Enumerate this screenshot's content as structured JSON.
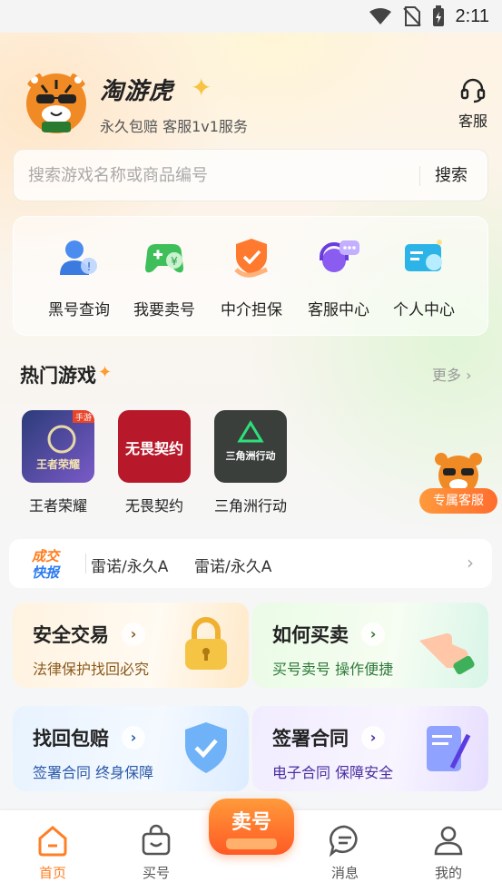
{
  "status_bar": {
    "time": "2:11"
  },
  "header": {
    "app_name": "淘游虎",
    "slogan": "永久包赔 客服1v1服务",
    "customer_service_label": "客服"
  },
  "search": {
    "placeholder": "搜索游戏名称或商品编号",
    "button_label": "搜索"
  },
  "quick_actions": [
    {
      "label": "黑号查询",
      "icon": "user-search-icon"
    },
    {
      "label": "我要卖号",
      "icon": "gamepad-sell-icon"
    },
    {
      "label": "中介担保",
      "icon": "shield-check-icon"
    },
    {
      "label": "客服中心",
      "icon": "headset-chat-icon"
    },
    {
      "label": "个人中心",
      "icon": "id-card-icon"
    }
  ],
  "hot_games": {
    "title": "热门游戏",
    "more_label": "更多",
    "items": [
      {
        "name": "王者荣耀",
        "icon_text": "王者荣耀",
        "tag": "手游"
      },
      {
        "name": "无畏契约",
        "icon_text": "无畏契约"
      },
      {
        "name": "三角洲行动",
        "icon_text": "三角洲行动"
      }
    ]
  },
  "floating_cs": {
    "label": "专属客服"
  },
  "ticker": {
    "badge_top": "成交",
    "badge_bottom": "快报",
    "items": [
      "雷诺/永久A",
      "雷诺/永久A"
    ]
  },
  "feature_cards": [
    {
      "title": "安全交易",
      "subtitle": "法律保护找回必究",
      "icon": "padlock-icon"
    },
    {
      "title": "如何买卖",
      "subtitle": "买号卖号 操作便捷",
      "icon": "pointing-hand-icon"
    },
    {
      "title": "找回包赔",
      "subtitle": "签署合同 终身保障",
      "icon": "shield-icon"
    },
    {
      "title": "签署合同",
      "subtitle": "电子合同 保障安全",
      "icon": "contract-icon"
    }
  ],
  "bottom_nav": {
    "items": [
      {
        "label": "首页",
        "active": true
      },
      {
        "label": "买号",
        "active": false
      },
      {
        "label": "消息",
        "active": false
      },
      {
        "label": "我的",
        "active": false
      }
    ],
    "sell_label": "卖号"
  },
  "colors": {
    "accent": "#ff7f24",
    "safe_trade_sub": "#8a5a1c",
    "howto_sub": "#2f7a3a",
    "recover_sub": "#2c5aa8",
    "contract_sub": "#4a2ea0"
  }
}
